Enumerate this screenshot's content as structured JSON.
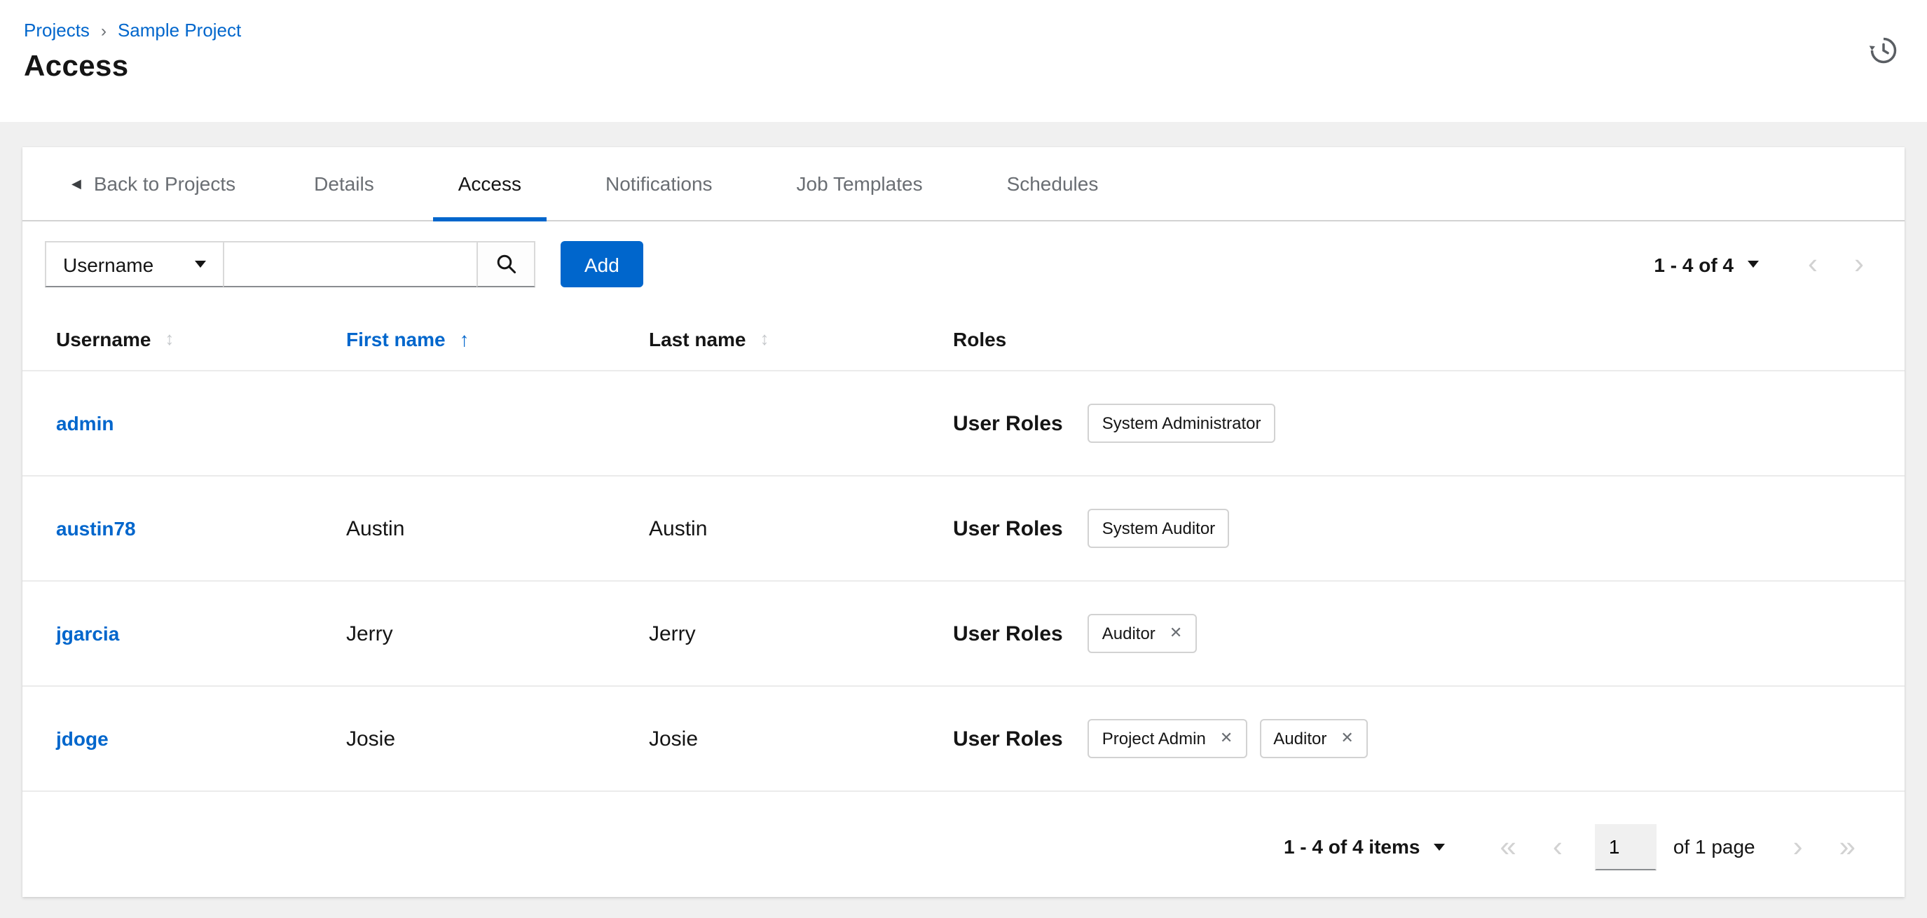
{
  "colors": {
    "primary": "#0066cc",
    "text_dark": "#151515",
    "text_gray": "#6a6e73",
    "border": "#d2d2d2"
  },
  "icons": {
    "sort_inactive": "↕",
    "sort_ascending": "↑",
    "caret_left": "◀",
    "close": "✕",
    "first_page": "«",
    "prev_page": "‹",
    "next_page": "›",
    "last_page": "»"
  },
  "breadcrumb": {
    "projects": "Projects",
    "separator": "›",
    "current": "Sample Project"
  },
  "page": {
    "title": "Access"
  },
  "tabs": {
    "back": "Back to Projects",
    "items": [
      {
        "label": "Details"
      },
      {
        "label": "Access",
        "active": true
      },
      {
        "label": "Notifications"
      },
      {
        "label": "Job Templates"
      },
      {
        "label": "Schedules"
      }
    ]
  },
  "toolbar": {
    "filter_key": "Username",
    "search_value": "",
    "add_label": "Add",
    "pagination_summary": "1 - 4 of 4"
  },
  "table": {
    "columns": [
      {
        "label": "Username",
        "sortable": true
      },
      {
        "label": "First name",
        "sortable": true,
        "sorted": "ascending"
      },
      {
        "label": "Last name",
        "sortable": true
      },
      {
        "label": "Roles",
        "sortable": false
      }
    ],
    "roles_label": "User Roles",
    "rows": [
      {
        "username": "admin",
        "first_name": "",
        "last_name": "",
        "roles": [
          {
            "label": "System Administrator",
            "removable": false
          }
        ]
      },
      {
        "username": "austin78",
        "first_name": "Austin",
        "last_name": "Austin",
        "roles": [
          {
            "label": "System Auditor",
            "removable": false
          }
        ]
      },
      {
        "username": "jgarcia",
        "first_name": "Jerry",
        "last_name": "Jerry",
        "roles": [
          {
            "label": "Auditor",
            "removable": true
          }
        ]
      },
      {
        "username": "jdoge",
        "first_name": "Josie",
        "last_name": "Josie",
        "roles": [
          {
            "label": "Project Admin",
            "removable": true
          },
          {
            "label": "Auditor",
            "removable": true
          }
        ]
      }
    ]
  },
  "footer": {
    "items_summary": "1 - 4 of 4 items",
    "current_page": "1",
    "page_label": "of 1 page"
  }
}
